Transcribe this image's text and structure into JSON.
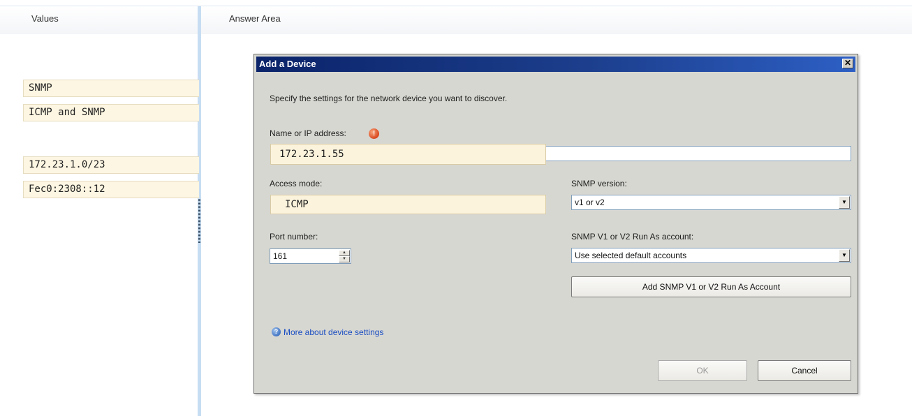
{
  "panels": {
    "values_title": "Values",
    "answer_title": "Answer Area"
  },
  "values": [
    "SNMP",
    "ICMP and SNMP",
    "",
    "172.23.1.0/23",
    "Fec0:2308::12"
  ],
  "dialog": {
    "title": "Add a Device",
    "close_label": "✕",
    "description": "Specify the settings for the network device you want to discover.",
    "name_label": "Name or IP address:",
    "warning_icon_glyph": "!",
    "name_value": "172.23.1.55",
    "access_mode_label": "Access mode:",
    "access_mode_value": "ICMP",
    "snmp_version_label": "SNMP version:",
    "snmp_version_value": "v1 or v2",
    "port_label": "Port number:",
    "port_value": "161",
    "run_as_label": "SNMP V1 or V2 Run As account:",
    "run_as_value": "Use selected default accounts",
    "add_account_button": "Add SNMP V1 or V2 Run As Account",
    "help_link": "More about device settings",
    "help_icon_glyph": "?",
    "ok_button": "OK",
    "cancel_button": "Cancel",
    "dropdown_arrow": "▼",
    "spin_up": "▲",
    "spin_down": "▼"
  },
  "colors": {
    "titlebar": "#0b246a",
    "tile": "#fdf6e2",
    "divider": "#c7ddf2",
    "link": "#1a4ec2"
  }
}
